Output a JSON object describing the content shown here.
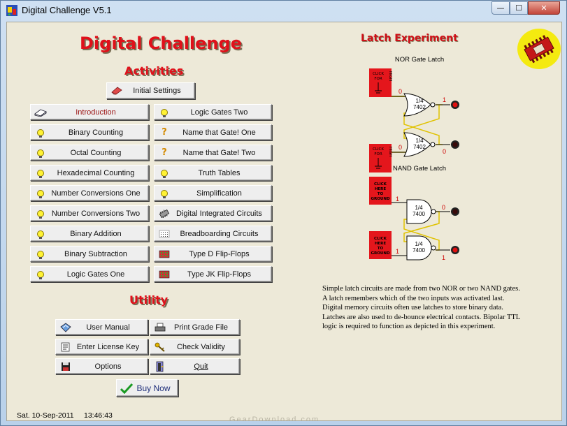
{
  "window": {
    "title": "Digital Challenge V5.1",
    "controls": {
      "minimize": "—",
      "maximize": "☐",
      "close": "✕"
    }
  },
  "app_heading": "Digital Challenge",
  "activities": {
    "heading": "Activities",
    "initial_settings": "Initial Settings",
    "left_column": [
      {
        "label": "Introduction",
        "icon": "book-icon"
      },
      {
        "label": "Binary Counting",
        "icon": "lightbulb-icon"
      },
      {
        "label": "Octal Counting",
        "icon": "lightbulb-icon"
      },
      {
        "label": "Hexadecimal Counting",
        "icon": "lightbulb-icon"
      },
      {
        "label": "Number Conversions One",
        "icon": "lightbulb-icon"
      },
      {
        "label": "Number Conversions Two",
        "icon": "lightbulb-icon"
      },
      {
        "label": "Binary Addition",
        "icon": "lightbulb-icon"
      },
      {
        "label": "Binary Subtraction",
        "icon": "lightbulb-icon"
      },
      {
        "label": "Logic Gates One",
        "icon": "lightbulb-icon"
      }
    ],
    "right_column": [
      {
        "label": "Logic Gates Two",
        "icon": "lightbulb-icon"
      },
      {
        "label": "Name that Gate! One",
        "icon": "question-icon"
      },
      {
        "label": "Name that Gate! Two",
        "icon": "question-icon"
      },
      {
        "label": "Truth Tables",
        "icon": "lightbulb-icon"
      },
      {
        "label": "Simplification",
        "icon": "lightbulb-icon"
      },
      {
        "label": "Digital Integrated Circuits",
        "icon": "chip-icon"
      },
      {
        "label": "Breadboarding Circuits",
        "icon": "breadboard-icon"
      },
      {
        "label": "Type D Flip-Flops",
        "icon": "flipflop-icon"
      },
      {
        "label": "Type JK Flip-Flops",
        "icon": "flipflop-icon"
      }
    ]
  },
  "utility": {
    "heading": "Utility",
    "user_manual": "User Manual",
    "print_grade_file": "Print Grade File",
    "enter_license_key": "Enter License Key",
    "check_validity": "Check Validity",
    "options": "Options",
    "quit": "Quit",
    "buy_now": "Buy Now"
  },
  "latch": {
    "heading": "Latch Experiment",
    "nor": {
      "title": "NOR Gate Latch",
      "switch_top_lines": [
        "CLICK",
        "FOR"
      ],
      "switch_high": "HIGH",
      "switch_bottom_lines": [
        "CLICK",
        "FOR"
      ],
      "gate_label_top": "1/4",
      "gate_part": "7402",
      "input_top": "0",
      "input_bottom": "0",
      "output_top": "1",
      "output_bottom": "0"
    },
    "nand": {
      "title": "NAND Gate Latch",
      "switch_lines": [
        "CLICK",
        "HERE",
        "TO",
        "GROUND"
      ],
      "gate_label_top": "1/4",
      "gate_part": "7400",
      "input_top": "1",
      "input_bottom": "1",
      "output_top": "0",
      "output_bottom": "1"
    },
    "led_on_color": "#e01010",
    "led_off_color": "#3a0a0a"
  },
  "description": "Simple latch circuits are made from two NOR or two NAND gates. A latch remembers which of the two inputs was activated last. Digital memory circuits often use latches to store binary data. Latches are also used to de-bounce electrical contacts. Bipolar TTL logic is required to function as depicted in this experiment.",
  "status": {
    "date": "Sat.  10-Sep-2011",
    "time": "13:46:43"
  },
  "watermark": "GearDownload.com",
  "colors": {
    "heading_red": "#e0101a",
    "switch_red": "#e4161c",
    "gate_fill": "#ffffff",
    "wire_yellow": "#e0c200"
  }
}
